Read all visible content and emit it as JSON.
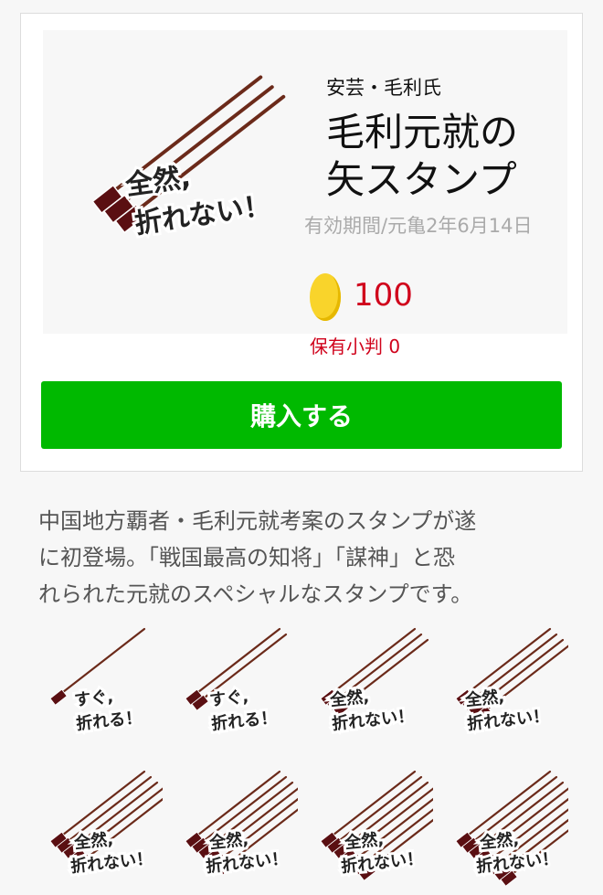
{
  "product": {
    "category": "安芸・毛利氏",
    "title_line1": "毛利元就の",
    "title_line2": "矢スタンプ",
    "validity": "有効期間/元亀2年6月14日",
    "price": "100",
    "owned_balance": "保有小判 0",
    "buy_label": "購入する",
    "main_sticker": {
      "caption_line1": "全然,",
      "caption_line2": "折れない！",
      "arrow_count": 3
    }
  },
  "description": {
    "line1": "中国地方覇者・毛利元就考案のスタンプが遂",
    "line2": "に初登場。「戦国最高の知将」「謀神」と恐",
    "line3": "れられた元就のスペシャルなスタンプです。"
  },
  "stickers": [
    {
      "caption_line1": "すぐ,",
      "caption_line2": "折れる！",
      "arrow_count": 1
    },
    {
      "caption_line1": "すぐ,",
      "caption_line2": "折れる！",
      "arrow_count": 2
    },
    {
      "caption_line1": "全然,",
      "caption_line2": "折れない！",
      "arrow_count": 3
    },
    {
      "caption_line1": "全然,",
      "caption_line2": "折れない！",
      "arrow_count": 4
    },
    {
      "caption_line1": "全然,",
      "caption_line2": "折れない！",
      "arrow_count": 5
    },
    {
      "caption_line1": "全然,",
      "caption_line2": "折れない！",
      "arrow_count": 6
    },
    {
      "caption_line1": "全然,",
      "caption_line2": "折れない！",
      "arrow_count": 7
    },
    {
      "caption_line1": "全然,",
      "caption_line2": "折れない！",
      "arrow_count": 8
    }
  ],
  "colors": {
    "buy_button": "#00b900",
    "price": "#d0021b",
    "coin": "#f9d42b",
    "arrow_shaft": "#6b2a1a",
    "arrow_fletching": "#5a0f12"
  },
  "icons": {
    "coin": "gold-coin-icon",
    "sticker": "arrow-bundle-sticker"
  }
}
